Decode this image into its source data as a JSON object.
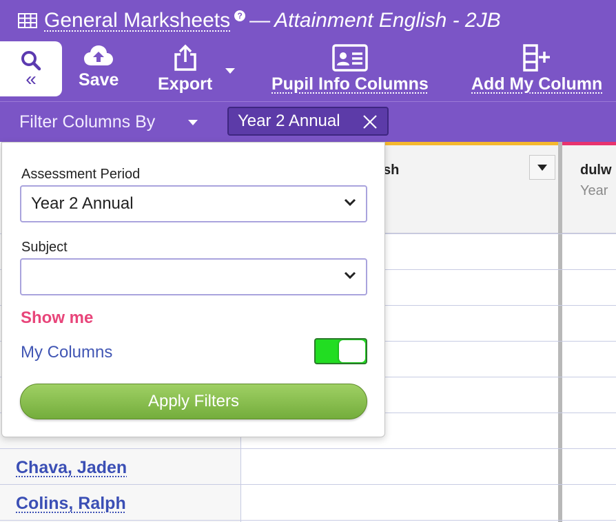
{
  "header": {
    "title": "General Marksheets",
    "help_glyph": "?",
    "separator": "—",
    "subtitle": "Attainment English - 2JB"
  },
  "toolbar": {
    "collapse_glyph": "«",
    "save_label": "Save",
    "export_label": "Export",
    "pupil_info_label": "Pupil Info Columns",
    "add_column_label": "Add My Column"
  },
  "filterbar": {
    "label": "Filter Columns By",
    "chip_label": "Year 2 Annual"
  },
  "grid": {
    "columns": [
      {
        "title_fragment": "sh",
        "accent": "#f5b82e"
      },
      {
        "title_fragment": "dulw",
        "subtitle_fragment": "Year",
        "accent": "#e8336e"
      }
    ],
    "pupils": [
      "Chava, Jaden",
      "Colins, Ralph"
    ]
  },
  "filter_panel": {
    "assessment_period_label": "Assessment Period",
    "assessment_period_value": "Year 2 Annual",
    "subject_label": "Subject",
    "subject_value": "",
    "show_me_label": "Show me",
    "my_columns_label": "My Columns",
    "my_columns_on": true,
    "apply_label": "Apply Filters"
  },
  "colors": {
    "brand": "#7b55c6",
    "chip_bg": "#5c3ba8",
    "link": "#3b4fb5",
    "show_me": "#e8457a",
    "toggle_on": "#22dd22",
    "apply": "#74ad3c"
  }
}
